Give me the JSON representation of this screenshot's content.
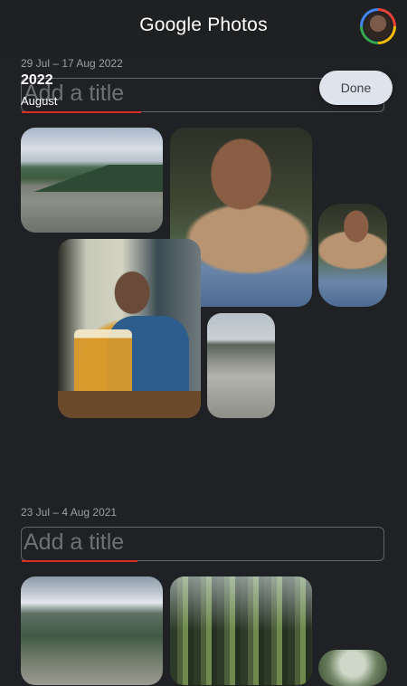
{
  "app": {
    "brand_google": "Google",
    "brand_photos": "Photos"
  },
  "avatar_icon": "user-avatar",
  "sections": [
    {
      "date_range": "29 Jul – 17 Aug 2022",
      "title_placeholder": "Add a title",
      "year_label": "2022",
      "month_label": "August",
      "done_label": "Done"
    },
    {
      "date_range": "23 Jul – 4 Aug 2021",
      "title_placeholder": "Add a title"
    }
  ],
  "colors": {
    "background": "#202124",
    "underline": "#d93025",
    "done_button": "#dfe3ec"
  }
}
